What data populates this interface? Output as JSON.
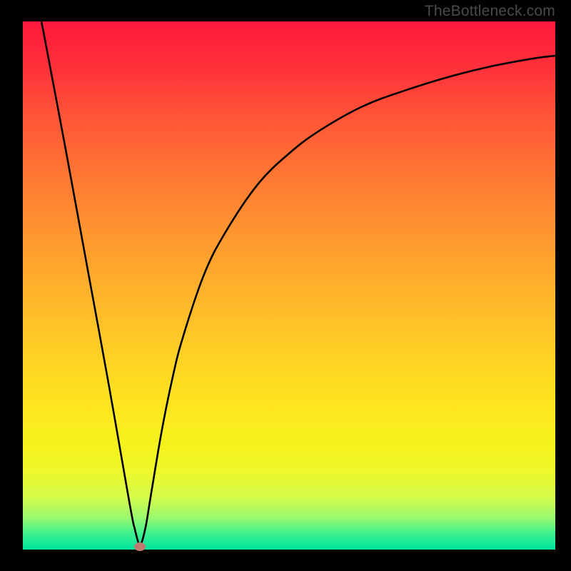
{
  "watermark": "TheBottleneck.com",
  "chart_data": {
    "type": "line",
    "title": "",
    "xlabel": "",
    "ylabel": "",
    "xlim": [
      0,
      100
    ],
    "ylim": [
      0,
      100
    ],
    "background_gradient": {
      "top": "#ff1a3d",
      "bottom": "#00e49f",
      "notes": "red (top/high) through orange/yellow to green (bottom/low)"
    },
    "series": [
      {
        "name": "bottleneck-curve",
        "notes": "V-shaped curve: steep linear descent on left, minimum near x~22, then concave-increasing curve to right",
        "x": [
          3.5,
          8,
          12,
          16,
          20,
          21,
          22,
          23,
          24,
          26,
          28,
          30,
          34,
          38,
          44,
          50,
          56,
          64,
          72,
          80,
          88,
          96,
          100
        ],
        "y": [
          100,
          76,
          54,
          32,
          9,
          4,
          1,
          4,
          10,
          22,
          32,
          40,
          52,
          60,
          69,
          75,
          79.5,
          84,
          87,
          89.5,
          91.5,
          93,
          93.5
        ]
      }
    ],
    "marker": {
      "x_pct": 22,
      "y_pct": 0.6,
      "color": "#c17a6e",
      "shape": "ellipse"
    },
    "axes_visible": false,
    "grid": false
  }
}
